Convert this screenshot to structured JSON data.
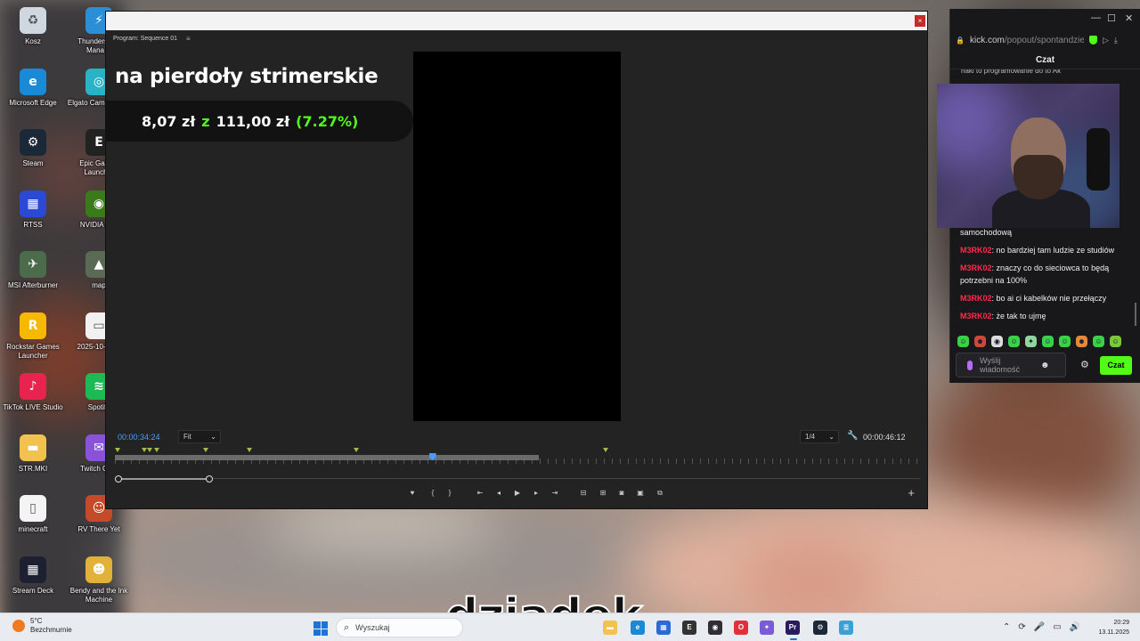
{
  "desktop": {
    "icons": [
      {
        "label": "Kosz",
        "icon": "recycle-bin-icon",
        "color": "#cfd8e0",
        "glyph": "♻"
      },
      {
        "label": "Thunderstore Mana…",
        "icon": "thunderstore-icon",
        "color": "#2a8fd6",
        "glyph": "⚡"
      },
      {
        "label": "Microsoft Edge",
        "icon": "edge-icon",
        "color": "#1a8ad6",
        "glyph": "e"
      },
      {
        "label": "Elgato Camera Hub",
        "icon": "elgato-icon",
        "color": "#2ab3c7",
        "glyph": "◎"
      },
      {
        "label": "Steam",
        "icon": "steam-icon",
        "color": "#1b2838",
        "glyph": "⚙"
      },
      {
        "label": "Epic Games Launcher",
        "icon": "epic-games-icon",
        "color": "#222",
        "glyph": "E"
      },
      {
        "label": "RTSS",
        "icon": "rtss-icon",
        "color": "#2a4ad6",
        "glyph": "▦"
      },
      {
        "label": "NVIDIA App",
        "icon": "nvidia-icon",
        "color": "#3a7a1a",
        "glyph": "◉"
      },
      {
        "label": "MSI Afterburner",
        "icon": "afterburner-icon",
        "color": "#4c6b4a",
        "glyph": "✈"
      },
      {
        "label": "map",
        "icon": "map-icon",
        "color": "#5b6a55",
        "glyph": "▲"
      },
      {
        "label": "Rockstar Games Launcher",
        "icon": "rockstar-icon",
        "color": "#f6b800",
        "glyph": "R"
      },
      {
        "label": "2025-10-01…",
        "icon": "image-file-icon",
        "color": "#f1f1f1",
        "glyph": "▭"
      },
      {
        "label": "TikTok LIVE Studio",
        "icon": "tiktok-icon",
        "color": "#e8244e",
        "glyph": "♪"
      },
      {
        "label": "Spotify",
        "icon": "spotify-icon",
        "color": "#1db954",
        "glyph": "≋"
      },
      {
        "label": "STR.MKI",
        "icon": "folder-icon",
        "color": "#f2c14e",
        "glyph": "▬"
      },
      {
        "label": "Twitch Chat",
        "icon": "twitch-chat-icon",
        "color": "#8a52d9",
        "glyph": "✉"
      },
      {
        "label": "minecraft",
        "icon": "file-icon",
        "color": "#f4f4f4",
        "glyph": "▯"
      },
      {
        "label": "RV There Yet",
        "icon": "rv-there-yet-icon",
        "color": "#c44a2a",
        "glyph": "☺"
      },
      {
        "label": "Stream Deck",
        "icon": "stream-deck-icon",
        "color": "#1d2030",
        "glyph": "▦"
      },
      {
        "label": "Bendy and the Ink Machine",
        "icon": "bendy-icon",
        "color": "#e2b13a",
        "glyph": "☻"
      }
    ],
    "wallpaper_caption": "dziadek"
  },
  "premiere": {
    "panel_title": "Program: Sequence 01",
    "panel_menu_icon": "≡",
    "close_glyph": "×",
    "overlay": {
      "title": "na pierdoły strimerskie",
      "current": "8,07 zł",
      "of_word": "z",
      "goal": "111,00 zł",
      "percent": "(7.27%)"
    },
    "timecode_current": "00:00:34:24",
    "fit_select": "Fit",
    "resolution_select": "1/4",
    "timecode_duration": "00:00:46:12",
    "playhead_fraction": 0.39,
    "transport_glyphs": {
      "marker": "♥",
      "mark_in": "{",
      "mark_out": "}",
      "go_to_in": "⇤",
      "step_back": "◂",
      "play": "▶",
      "step_forward": "▸",
      "go_to_out": "⇥",
      "lift": "⊟",
      "extract": "⊞",
      "export_frame": "◙",
      "insert": "▣",
      "compare": "⧉",
      "add": "+"
    },
    "accent_color": "#4a9cff"
  },
  "kick": {
    "url_host": "kick.com",
    "url_path": "/popout/spontandzie",
    "chat_title": "Czat",
    "cut_text": "haki to programowanie do to Ak",
    "messages": [
      {
        "user": "",
        "text": "samochodową"
      },
      {
        "user": "M3RK02",
        "text": ": no bardziej tam ludzie ze studiów"
      },
      {
        "user": "M3RK02",
        "text": ": znaczy co do sieciowca to będą potrzebni na 100%"
      },
      {
        "user": "M3RK02",
        "text": ": bo ai ci kabelków nie przełączy"
      },
      {
        "user": "M3RK02",
        "text": ": że tak to ujmę"
      }
    ],
    "input_placeholder": "Wyślij wiadomość",
    "send_label": "Czat",
    "brand_color": "#53fc18",
    "username_color": "#ff2a4a"
  },
  "taskbar": {
    "weather_temp": "5°C",
    "weather_desc": "Bezchmurnie",
    "search_placeholder": "Wyszukaj",
    "time": "20:29",
    "date": "13.11.2025",
    "apps": [
      {
        "name": "file-explorer-taskbar-icon",
        "color": "#f2c14e",
        "glyph": "▬"
      },
      {
        "name": "edge-taskbar-icon",
        "color": "#1a8ad6",
        "glyph": "e"
      },
      {
        "name": "store-taskbar-icon",
        "color": "#2a6ad6",
        "glyph": "▦"
      },
      {
        "name": "epic-games-taskbar-icon",
        "color": "#333",
        "glyph": "E"
      },
      {
        "name": "obs-taskbar-icon",
        "color": "#302e31",
        "glyph": "◉"
      },
      {
        "name": "opera-taskbar-icon",
        "color": "#e0303a",
        "glyph": "O"
      },
      {
        "name": "copilot-taskbar-icon",
        "color": "#7a5ad6",
        "glyph": "✦"
      },
      {
        "name": "premiere-taskbar-icon",
        "color": "#2a1a5e",
        "glyph": "Pr"
      },
      {
        "name": "steam-taskbar-icon",
        "color": "#1b2838",
        "glyph": "⚙"
      },
      {
        "name": "notepad-taskbar-icon",
        "color": "#3aa0d6",
        "glyph": "≣"
      }
    ]
  }
}
